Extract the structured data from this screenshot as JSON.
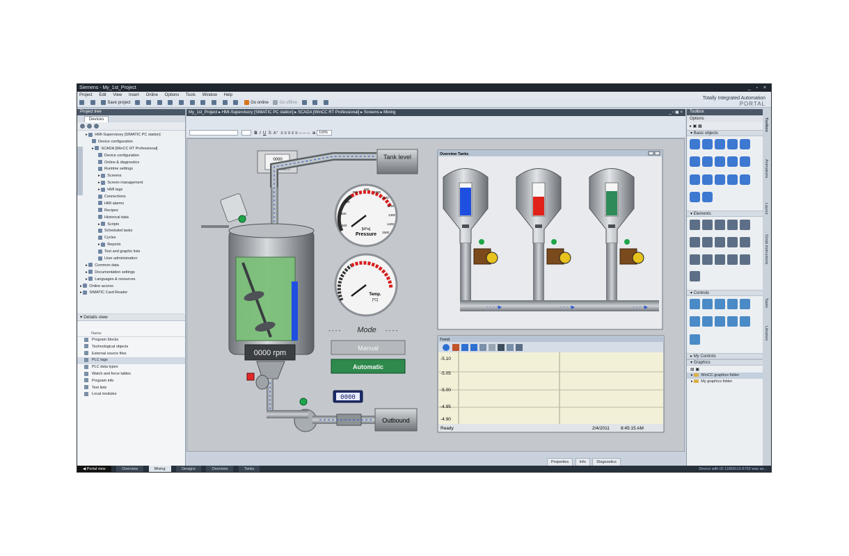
{
  "window": {
    "title": "Siemens  -  My_1st_Project",
    "controls": "_ ▫ ×"
  },
  "menu": [
    "Project",
    "Edit",
    "View",
    "Insert",
    "Online",
    "Options",
    "Tools",
    "Window",
    "Help"
  ],
  "toolbar": {
    "save_label": "Save project",
    "go_online": "Go online",
    "go_offline": "Go offline"
  },
  "brand": {
    "line1": "Totally Integrated Automation",
    "line2": "PORTAL"
  },
  "project_tree": {
    "title": "Project tree",
    "tab": "Devices",
    "items": [
      {
        "label": "HMI-Supervisory [SIMATIC PC station]",
        "indent": 0
      },
      {
        "label": "Device configuration",
        "indent": 1
      },
      {
        "label": "SCADA [WinCC RT Professional]",
        "indent": 1
      },
      {
        "label": "Device configuration",
        "indent": 2
      },
      {
        "label": "Online & diagnostics",
        "indent": 2
      },
      {
        "label": "Runtime settings",
        "indent": 2
      },
      {
        "label": "Screens",
        "indent": 2
      },
      {
        "label": "Screen management",
        "indent": 2
      },
      {
        "label": "HMI tags",
        "indent": 2
      },
      {
        "label": "Connections",
        "indent": 2
      },
      {
        "label": "HMI alarms",
        "indent": 2
      },
      {
        "label": "Recipes",
        "indent": 2
      },
      {
        "label": "Historical data",
        "indent": 2
      },
      {
        "label": "Scripts",
        "indent": 2
      },
      {
        "label": "Scheduled tasks",
        "indent": 2
      },
      {
        "label": "Cycles",
        "indent": 2
      },
      {
        "label": "Reports",
        "indent": 2
      },
      {
        "label": "Text and graphic lists",
        "indent": 2
      },
      {
        "label": "User administration",
        "indent": 2
      },
      {
        "label": "Common data",
        "indent": 0
      },
      {
        "label": "Documentation settings",
        "indent": 0
      },
      {
        "label": "Languages & resources",
        "indent": 0
      },
      {
        "label": "Online access",
        "indent": -1
      },
      {
        "label": "SIMATIC Card Reader",
        "indent": -1
      }
    ]
  },
  "details_view": {
    "title": "Details view",
    "column": "Name",
    "items": [
      "Program blocks",
      "Technological objects",
      "External source files",
      "PLC tags",
      "PLC data types",
      "Watch and force tables",
      "Program info",
      "Text lists",
      "Local modules"
    ]
  },
  "breadcrumb": "My_1st_Project  ▸  HMI-Supervisory [SIMATIC PC station]  ▸  SCADA [WinCC RT Professional]  ▸  Screens  ▸  Mixing",
  "format_bar": {
    "zoom": "100%"
  },
  "screen": {
    "counter_top": "0000",
    "counter_top_unit": "[mm]",
    "tank_level_btn": "Tank level",
    "pressure_label": "[kPa]",
    "pressure_name": "Pressure",
    "pressure_ticks": [
      "800",
      "900",
      "1000",
      "1100",
      "1200",
      "1300",
      "1400",
      "1500",
      "500",
      "600",
      "700"
    ],
    "temp_label": "Temp.",
    "temp_unit": "[°C]",
    "mode_title": "Mode",
    "manual_btn": "Manual",
    "automatic_btn": "Automatic",
    "rpm": "0000 rpm",
    "flow": "0000",
    "outbound_btn": "Outbound"
  },
  "overview": {
    "title": "Overview Tanks"
  },
  "trend": {
    "title": "Trend",
    "y_ticks": [
      "-5.10",
      "-5.05",
      "-5.00",
      "-4.95",
      "-4.90"
    ],
    "status": "Ready",
    "date": "2/4/2011",
    "time": "8:45:15 AM"
  },
  "toolbox": {
    "title": "Toolbox",
    "options": "Options",
    "sections": [
      "Basic objects",
      "Elements",
      "Controls",
      "My Controls",
      "Graphics"
    ],
    "graphics_items": [
      "WinCC graphics folder",
      "My graphics folder"
    ]
  },
  "side_tabs": [
    "Toolbox",
    "Animations",
    "Layout",
    "Script instructions",
    "Tasks",
    "Libraries"
  ],
  "bottom": {
    "portal_view": "◀  Portal view",
    "tabs": [
      "Overview",
      "Mixing",
      "Designs",
      "Overview",
      "Tanks"
    ],
    "status": "Device with ID 11868113-5792 was se..."
  },
  "inspector_tabs": [
    "Properties",
    "Info",
    "Diagnostics"
  ],
  "colors": {
    "blue_tank": "#1f4fe0",
    "red_tank": "#e0221a",
    "green_tank": "#2e8a59",
    "accent": "#0f6b3a"
  }
}
